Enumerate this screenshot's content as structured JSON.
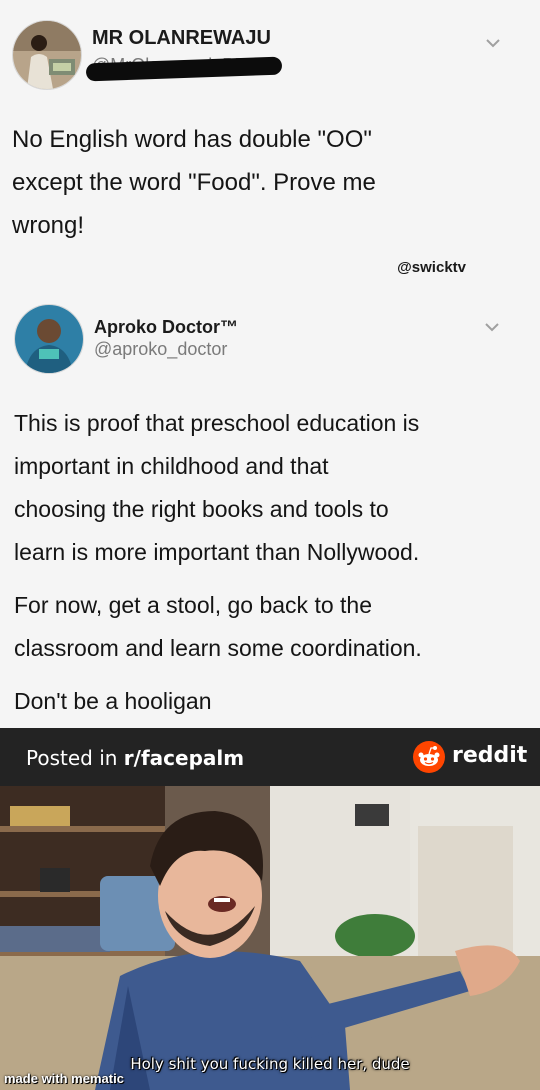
{
  "tweet1": {
    "name": "MR OLANREWAJU",
    "handle": "@MrOlanrewajuPR",
    "lines": [
      "No English word has double \"OO\"",
      "except the word \"Food\".  Prove me",
      "wrong!"
    ],
    "watermark": "@swicktv"
  },
  "tweet2": {
    "name": "Aproko Doctor™",
    "handle": "@aproko_doctor",
    "para1": [
      "This is proof that preschool education is",
      "important in childhood and that",
      "choosing the right books and tools to",
      "learn is more important than Nollywood."
    ],
    "para2": [
      "For now, get a stool, go back to the",
      "classroom and learn some coordination."
    ],
    "para3": "Don't be a hooligan"
  },
  "reddit_bar": {
    "posted_prefix": "Posted in ",
    "subreddit": "r/facepalm",
    "brand": "reddit",
    "brand_color": "#ff4500"
  },
  "meme": {
    "caption": "Holy shit you fucking killed her, dude",
    "credit": "made with mematic"
  }
}
